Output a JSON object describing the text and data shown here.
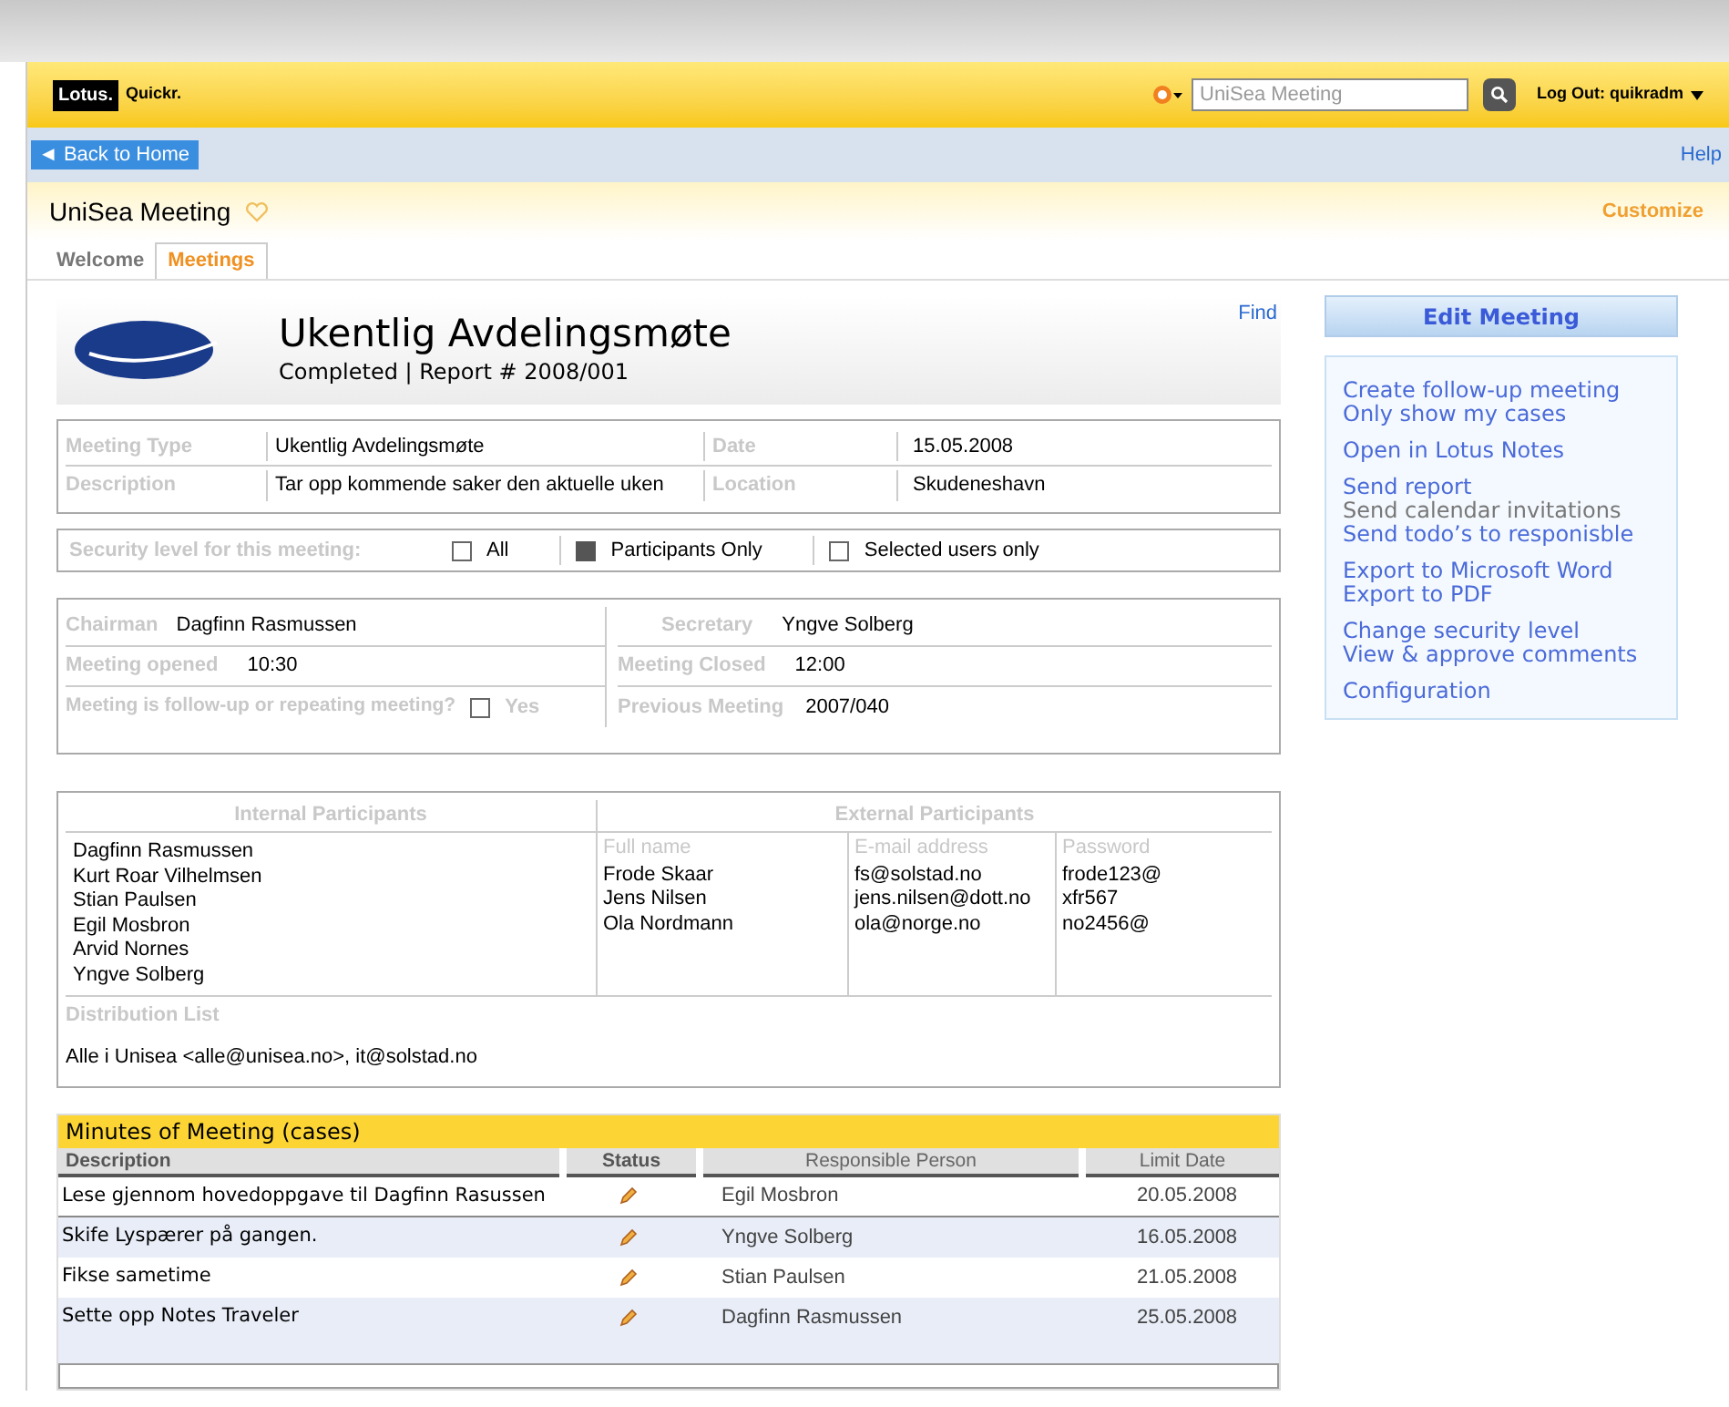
{
  "header": {
    "brand_lotus": "Lotus.",
    "brand_quickr": "Quickr.",
    "search": {
      "placeholder": "UniSea Meeting"
    },
    "logout": "Log Out: quikradm"
  },
  "nav": {
    "back": "◄ Back to Home",
    "help": "Help"
  },
  "place": {
    "title": "UniSea Meeting",
    "customize": "Customize"
  },
  "tabs": [
    {
      "label": "Welcome",
      "selected": false
    },
    {
      "label": "Meetings",
      "selected": true
    }
  ],
  "find": "Find",
  "meeting": {
    "title": "Ukentlig Avdelingsmøte",
    "subtitle": "Completed | Report # 2008/001"
  },
  "details": [
    {
      "label": "Meeting Type",
      "value": "Ukentlig Avdelingsmøte",
      "label2": "Date",
      "value2": "15.05.2008"
    },
    {
      "label": "Description",
      "value": "Tar opp kommende saker den aktuelle uken",
      "label2": "Location",
      "value2": "Skudeneshavn"
    }
  ],
  "security": {
    "label": "Security level for this meeting:",
    "options": [
      {
        "label": "All",
        "checked": false
      },
      {
        "label": "Participants Only",
        "checked": true
      },
      {
        "label": "Selected users only",
        "checked": false
      }
    ]
  },
  "roles": {
    "chairman_label": "Chairman",
    "chairman": "Dagfinn Rasmussen",
    "secretary_label": "Secretary",
    "secretary": "Yngve Solberg",
    "opened_label": "Meeting opened",
    "opened": "10:30",
    "closed_label": "Meeting Closed",
    "closed": "12:00",
    "followup_label": "Meeting is follow-up or repeating meeting?",
    "followup_option": "Yes",
    "followup_checked": false,
    "previous_label": "Previous Meeting",
    "previous": "2007/040"
  },
  "participants": {
    "internal_title": "Internal Participants",
    "internal": [
      "Dagfinn Rasmussen",
      "Kurt Roar Vilhelmsen",
      "Stian Paulsen",
      "Egil Mosbron",
      "Arvid Nornes",
      "Yngve Solberg"
    ],
    "external_title": "External Participants",
    "columns": [
      "Full name",
      "E-mail address",
      "Password"
    ],
    "external": [
      {
        "name": "Frode Skaar",
        "email": "fs@solstad.no",
        "password": "frode123@"
      },
      {
        "name": "Jens Nilsen",
        "email": "jens.nilsen@dott.no",
        "password": "xfr567"
      },
      {
        "name": "Ola Nordmann",
        "email": "ola@norge.no",
        "password": "no2456@"
      }
    ],
    "distribution_label": "Distribution List",
    "distribution": "Alle i Unisea <alle@unisea.no>, it@solstad.no"
  },
  "minutes": {
    "title": "Minutes of Meeting (cases)",
    "columns": [
      "Description",
      "Status",
      "Responsible Person",
      "Limit Date"
    ],
    "rows": [
      {
        "description": "Lese gjennom hovedoppgave til Dagfinn Rasussen",
        "person": "Egil Mosbron",
        "date": "20.05.2008"
      },
      {
        "description": "Skife Lyspærer på gangen.",
        "person": "Yngve Solberg",
        "date": "16.05.2008"
      },
      {
        "description": "Fikse sametime",
        "person": "Stian Paulsen",
        "date": "21.05.2008"
      },
      {
        "description": "Sette opp Notes Traveler",
        "person": "Dagfinn Rasmussen",
        "date": "25.05.2008"
      }
    ]
  },
  "actions": {
    "title": "Edit Meeting",
    "groups": [
      [
        {
          "label": "Create follow-up meeting",
          "disabled": false
        },
        {
          "label": "Only show my cases",
          "disabled": false
        }
      ],
      [
        {
          "label": "Open in Lotus Notes",
          "disabled": false
        }
      ],
      [
        {
          "label": "Send report",
          "disabled": false
        },
        {
          "label": "Send calendar invitations",
          "disabled": true
        },
        {
          "label": "Send todo’s to responisble",
          "disabled": false
        }
      ],
      [
        {
          "label": "Export to Microsoft Word",
          "disabled": false
        },
        {
          "label": "Export to PDF",
          "disabled": false
        }
      ],
      [
        {
          "label": "Change security level",
          "disabled": false
        },
        {
          "label": "View & approve comments",
          "disabled": false
        }
      ],
      [
        {
          "label": "Configuration",
          "disabled": false
        }
      ]
    ]
  }
}
